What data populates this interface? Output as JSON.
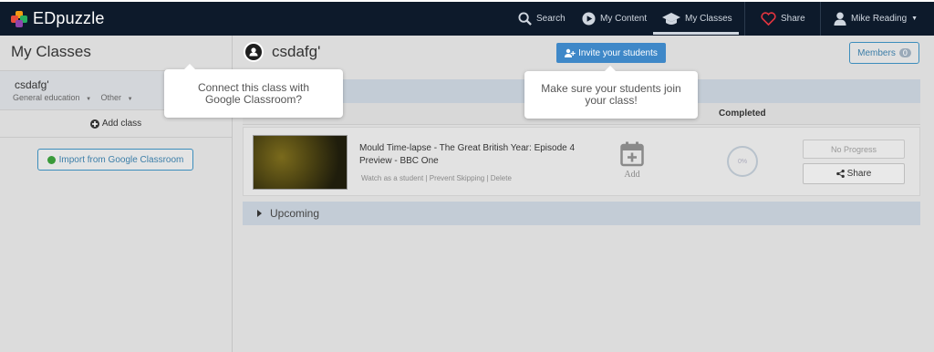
{
  "nav": {
    "brand": "EDpuzzle",
    "search": "Search",
    "my_content": "My Content",
    "my_classes": "My Classes",
    "share": "Share",
    "user": "Mike Reading"
  },
  "sidebar": {
    "title": "My Classes",
    "class_name": "csdafg'",
    "class_category": "General education",
    "class_subject": "Other",
    "add_class": "Add class",
    "import_label": "Import from Google Classroom"
  },
  "main": {
    "class_title": "csdafg'",
    "invite_label": "Invite your students",
    "members_label": "Members",
    "members_count": "0",
    "col_completed": "Completed",
    "video": {
      "title": "Mould Time-lapse - The Great British Year: Episode 4 Preview - BBC One",
      "link_watch": "Watch as a student",
      "link_prevent": "Prevent Skipping",
      "link_delete": "Delete",
      "add_label": "Add",
      "progress": "0%",
      "no_progress": "No Progress",
      "share": "Share"
    },
    "upcoming": "Upcoming"
  },
  "tooltips": {
    "google": "Connect this class with Google Classroom?",
    "invite": "Make sure your students join your class!"
  },
  "colors": {
    "nav_bg": "#0d1a2b",
    "primary": "#3f88c8",
    "section_bar": "#c3ccd6"
  }
}
